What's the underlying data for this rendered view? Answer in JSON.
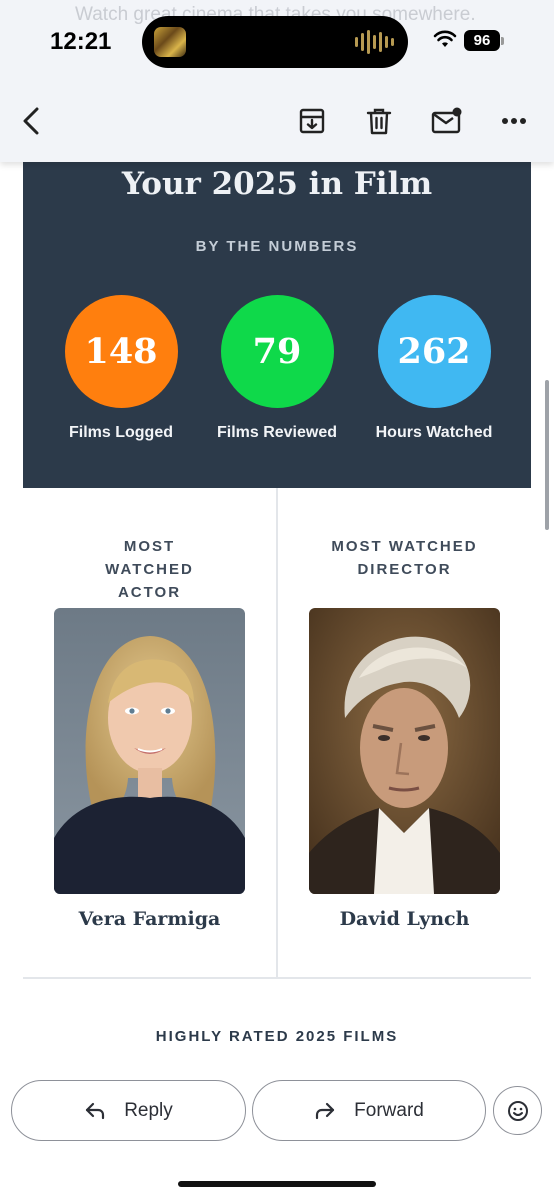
{
  "status_bar": {
    "time": "12:21",
    "battery": "96",
    "behind_text": "Watch great cinema that takes you somewhere."
  },
  "toolbar": {
    "icons": [
      "back-arrow-icon",
      "archive-icon",
      "trash-icon",
      "mail-unread-icon",
      "more-icon"
    ]
  },
  "email": {
    "title": "Your 2025 in Film",
    "subtitle": "BY THE NUMBERS",
    "stats": [
      {
        "value": "148",
        "label": "Films Logged",
        "color": "#ff7f0e"
      },
      {
        "value": "79",
        "label": "Films Reviewed",
        "color": "#0fd94a"
      },
      {
        "value": "262",
        "label": "Hours Watched",
        "color": "#40b8f2"
      }
    ],
    "actor": {
      "heading": "MOST WATCHED ACTOR",
      "name": "Vera Farmiga"
    },
    "director": {
      "heading": "MOST WATCHED DIRECTOR",
      "name": "David Lynch"
    },
    "next_section": "HIGHLY RATED 2025 FILMS"
  },
  "actions": {
    "reply_label": "Reply",
    "forward_label": "Forward"
  },
  "colors": {
    "panel_bg": "#2c3a4a",
    "toolbar_bg": "#f2f4f8"
  }
}
